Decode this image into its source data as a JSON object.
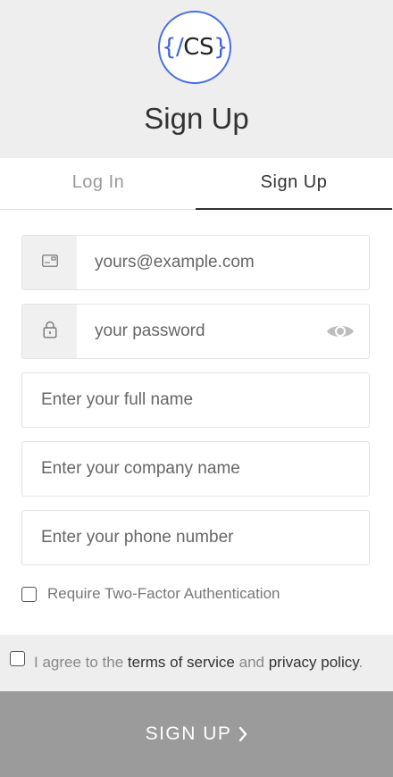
{
  "header": {
    "logo": {
      "brace_open": "{",
      "slash": "/",
      "letters": "CS",
      "brace_close": "}"
    },
    "title": "Sign Up"
  },
  "tabs": [
    {
      "label": "Log In",
      "active": false
    },
    {
      "label": "Sign Up",
      "active": true
    }
  ],
  "form": {
    "email": {
      "icon": "envelope-icon",
      "placeholder": "yours@example.com",
      "value": ""
    },
    "password": {
      "icon": "lock-icon",
      "placeholder": "your password",
      "value": "",
      "toggle_icon": "eye-icon"
    },
    "full_name": {
      "placeholder": "Enter your full name",
      "value": ""
    },
    "company": {
      "placeholder": "Enter your company name",
      "value": ""
    },
    "phone": {
      "placeholder": "Enter your phone number",
      "value": ""
    },
    "mfa": {
      "label": "Require Two-Factor Authentication",
      "checked": false
    }
  },
  "terms": {
    "prefix": "I agree to the ",
    "tos_link": "terms of service",
    "middle": " and ",
    "privacy_link": "privacy policy",
    "suffix": ".",
    "checked": false
  },
  "submit": {
    "label": "SIGN UP",
    "icon": "chevron-right-icon"
  },
  "colors": {
    "accent": "#3b63e0",
    "header_bg": "#eeeeee",
    "submit_bg": "#9b9b9b"
  }
}
